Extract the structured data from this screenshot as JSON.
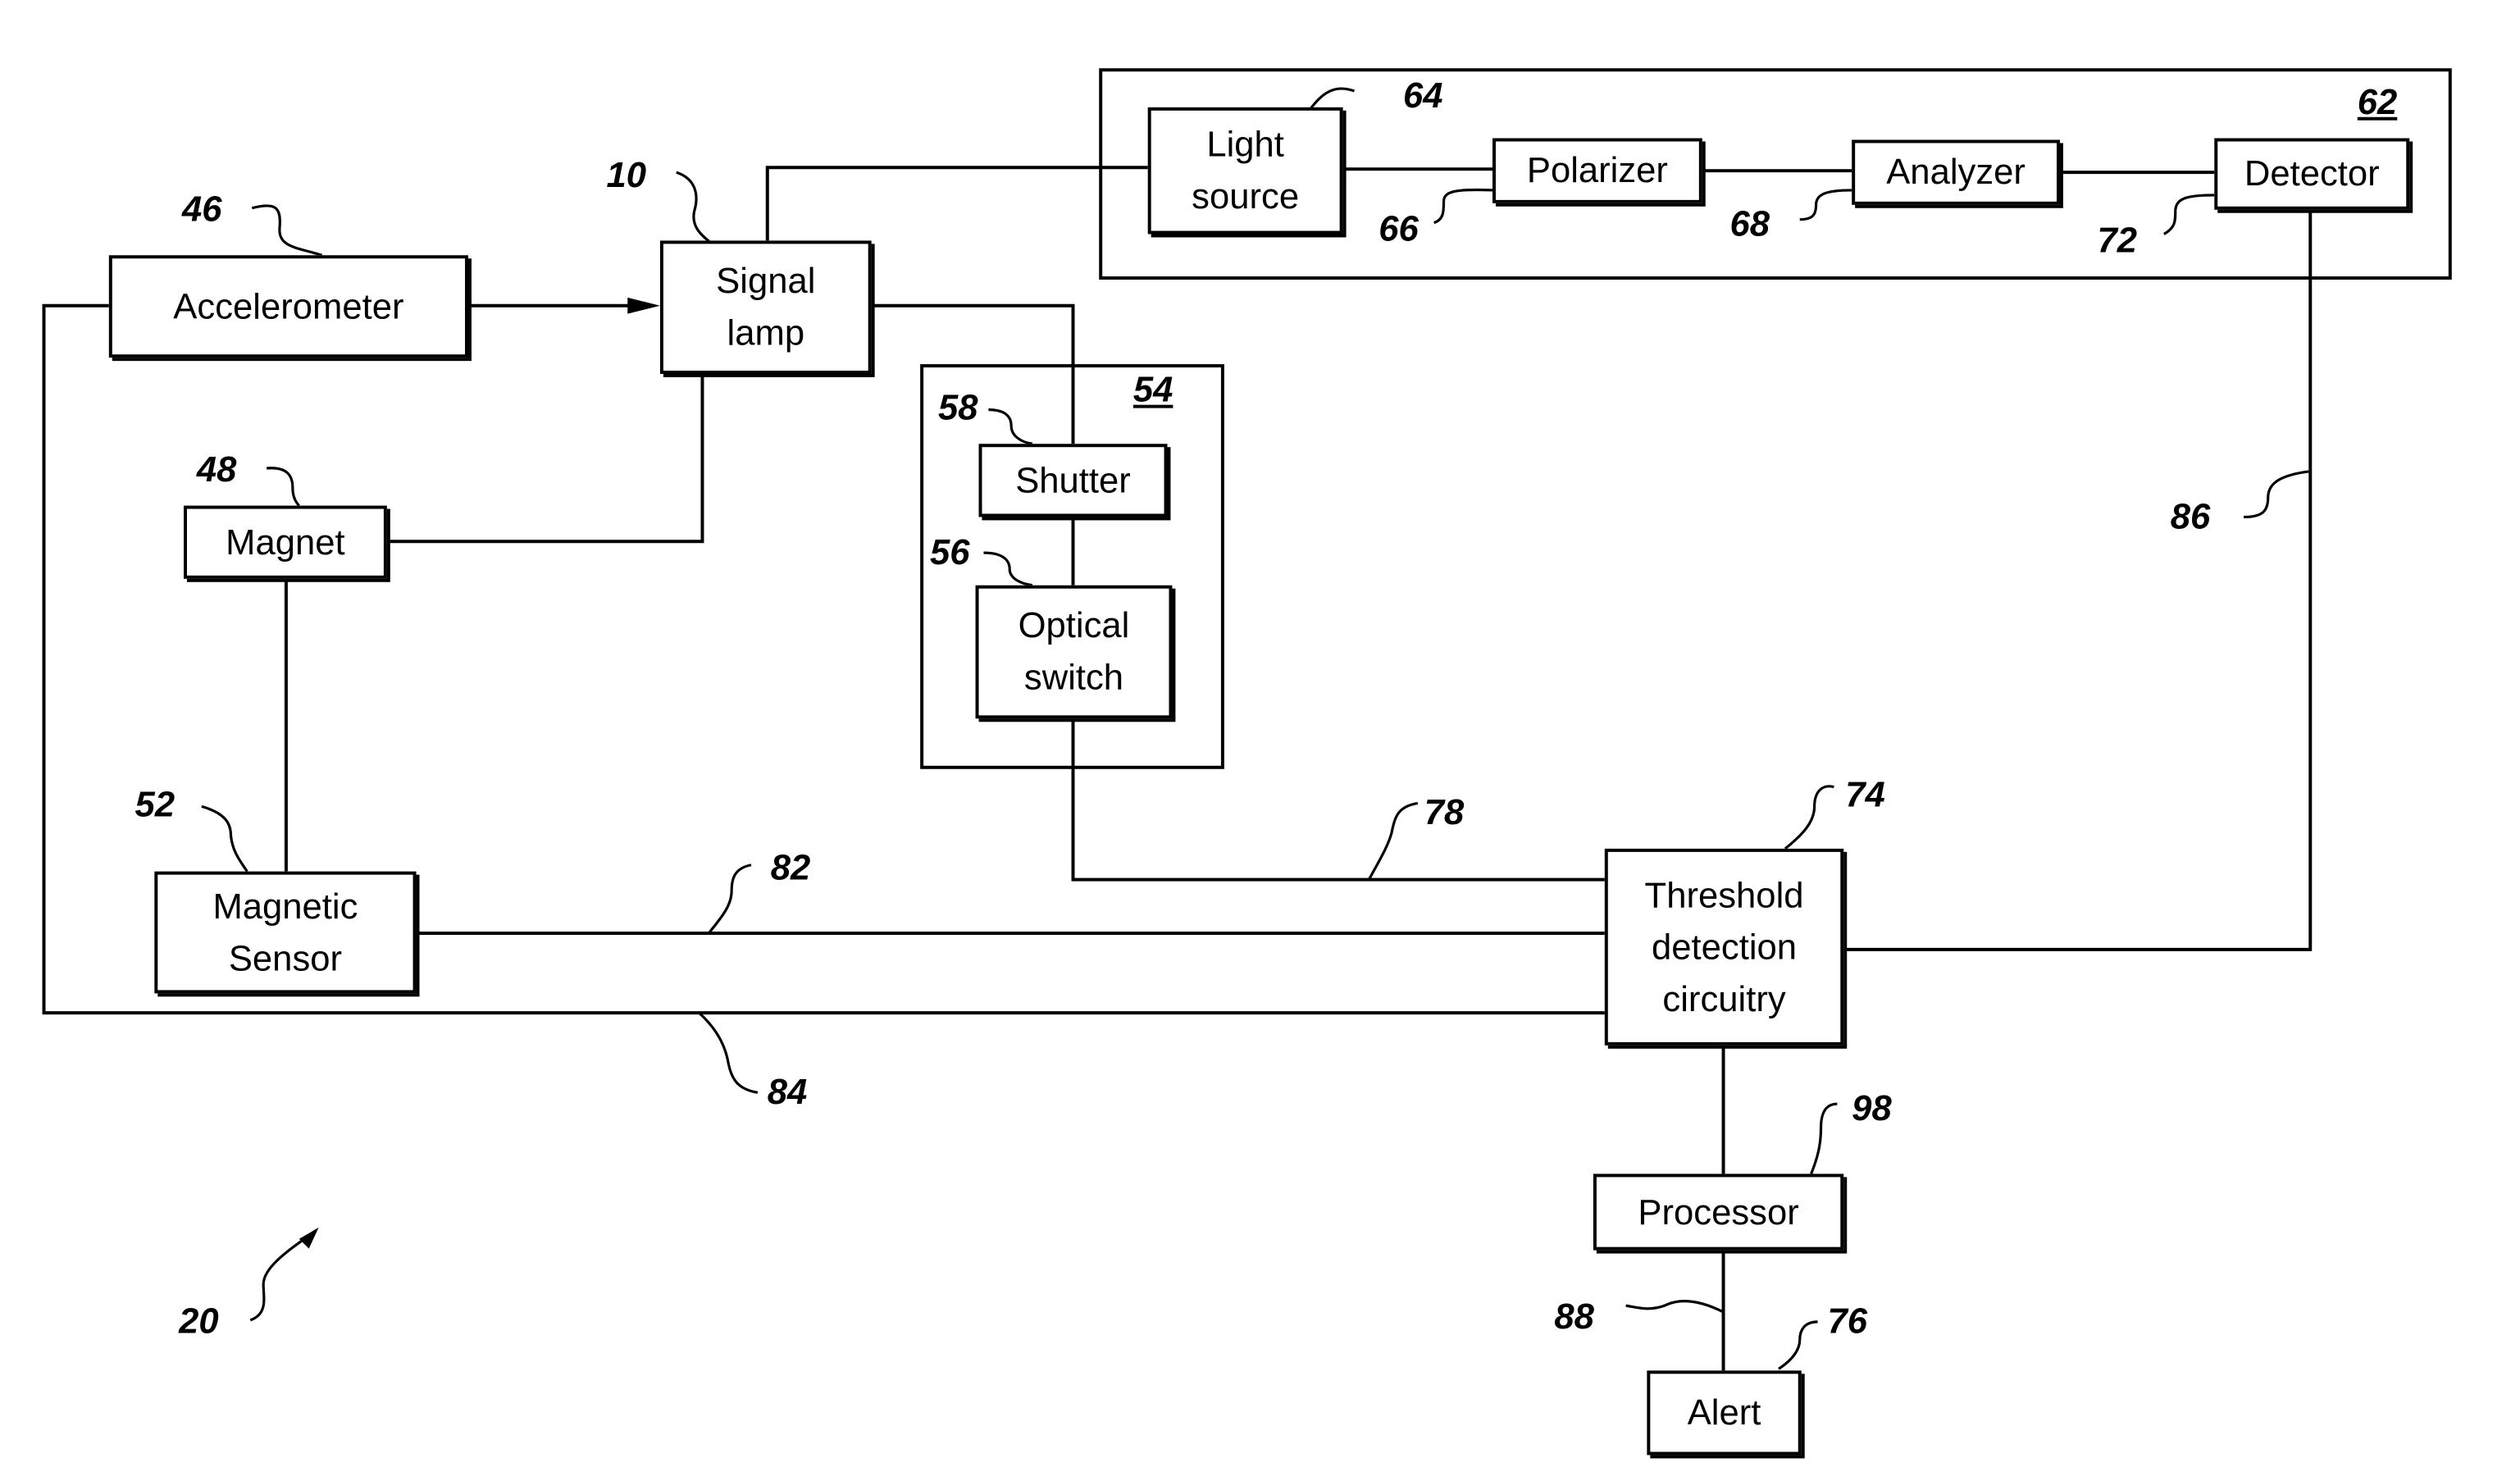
{
  "figure_number": "20",
  "blocks": {
    "accelerometer": {
      "label": "Accelerometer",
      "ref": "46"
    },
    "signal_lamp": {
      "label": "Signal lamp",
      "line1": "Signal",
      "line2": "lamp",
      "ref": "10"
    },
    "magnet": {
      "label": "Magnet",
      "ref": "48"
    },
    "magnetic_sensor": {
      "label": "Magnetic Sensor",
      "line1": "Magnetic",
      "line2": "Sensor",
      "ref": "52"
    },
    "light_source": {
      "label": "Light source",
      "line1": "Light",
      "line2": "source",
      "ref": "64"
    },
    "polarizer": {
      "label": "Polarizer",
      "ref": "66"
    },
    "analyzer": {
      "label": "Analyzer",
      "ref": "68"
    },
    "detector": {
      "label": "Detector",
      "ref": "72"
    },
    "shutter": {
      "label": "Shutter",
      "ref": "58"
    },
    "optical_switch": {
      "label": "Optical switch",
      "line1": "Optical",
      "line2": "switch",
      "ref": "56"
    },
    "threshold": {
      "label": "Threshold detection circuitry",
      "line1": "Threshold",
      "line2": "detection",
      "line3": "circuitry",
      "ref": "74"
    },
    "processor": {
      "label": "Processor",
      "ref": "98"
    },
    "alert": {
      "label": "Alert",
      "ref": "76"
    }
  },
  "groups": {
    "optical_sensor_group": {
      "ref": "62"
    },
    "shutter_group": {
      "ref": "54"
    }
  },
  "connections": {
    "optical_switch_to_threshold": "78",
    "magnetic_sensor_to_threshold": "82",
    "accelerometer_to_threshold": "84",
    "detector_to_threshold": "86",
    "processor_to_alert": "88"
  }
}
